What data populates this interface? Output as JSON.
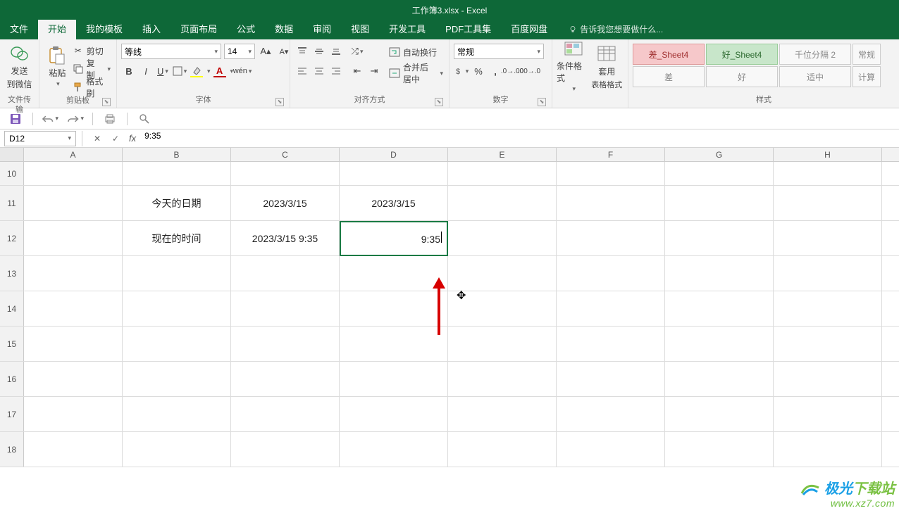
{
  "app": {
    "title": "工作簿3.xlsx - Excel"
  },
  "menu": {
    "file": "文件",
    "home": "开始",
    "templates": "我的模板",
    "insert": "插入",
    "layout": "页面布局",
    "formulas": "公式",
    "data": "数据",
    "review": "审阅",
    "view": "视图",
    "dev": "开发工具",
    "pdf": "PDF工具集",
    "baidu": "百度网盘",
    "tell": "告诉我您想要做什么..."
  },
  "ribbon": {
    "wechat_send": "发送",
    "wechat_to": "到微信",
    "wechat_group": "文件传输",
    "paste": "粘贴",
    "cut": "剪切",
    "copy": "复制",
    "format_painter": "格式刷",
    "clipboard_group": "剪贴板",
    "font_name": "等线",
    "font_size": "14",
    "font_group": "字体",
    "wrap": "自动换行",
    "merge": "合并后居中",
    "align_group": "对齐方式",
    "numfmt": "常规",
    "number_group": "数字",
    "cond_fmt": "条件格式",
    "table_fmt_l1": "套用",
    "table_fmt_l2": "表格格式",
    "style_bad": "差_Sheet4",
    "style_good": "好_Sheet4",
    "style_thou": "千位分隔 2",
    "style_normal": "常规",
    "style_bad2": "差",
    "style_good2": "好",
    "style_mid": "适中",
    "style_calc": "计算",
    "styles_group": "样式"
  },
  "fx": {
    "name": "D12",
    "value": "9:35"
  },
  "cols": {
    "A": "A",
    "B": "B",
    "C": "C",
    "D": "D",
    "E": "E",
    "F": "F",
    "G": "G",
    "H": "H"
  },
  "rows": {
    "r10": "10",
    "r11": "11",
    "r12": "12",
    "r13": "13",
    "r14": "14",
    "r15": "15",
    "r16": "16",
    "r17": "17",
    "r18": "18"
  },
  "cells": {
    "b11": "今天的日期",
    "c11": "2023/3/15",
    "d11": "2023/3/15",
    "b12": "现在的时间",
    "c12": "2023/3/15 9:35",
    "d12": "9:35"
  },
  "watermark": {
    "name_part1": "极光",
    "name_part2": "下载站",
    "url": "www.xz7.com"
  }
}
